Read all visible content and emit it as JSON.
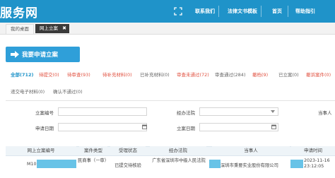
{
  "header": {
    "title": "服务网",
    "nav": [
      "联系我们",
      "法律文书模板",
      "首页",
      "帮助指引"
    ]
  },
  "tabs": [
    {
      "label": "我的桌面"
    },
    {
      "label": "网上立案"
    }
  ],
  "apply_button": {
    "label": "我要申请立案"
  },
  "filters": [
    {
      "label": "全部(712)"
    },
    {
      "label": "待提交(0)"
    },
    {
      "label": "待审查(93)"
    },
    {
      "label": "待补充材料(0)"
    },
    {
      "label": "已补充材料(0)"
    },
    {
      "label": "审查未通过(72)"
    },
    {
      "label": "审查通过(284)"
    },
    {
      "label": "撤档(9)"
    },
    {
      "label": "已立案(0)"
    },
    {
      "label": "撤诉案件(0)"
    },
    {
      "label": "递交电子材料(0)"
    },
    {
      "label": "确认不通过(0)"
    }
  ],
  "form": {
    "case_no_label": "立案编号",
    "court_label": "经办法院",
    "party_label": "当事人",
    "apply_date_label": "申请日期",
    "filing_date_label": "立案日期"
  },
  "table": {
    "headers": [
      "网上立案编号",
      "案件类型",
      "受理状态",
      "经办法院",
      "当事人",
      "申请时间"
    ],
    "rows": [
      {
        "case_no": "M10",
        "case_type": "民商事（一审）",
        "status": "已提交待核验",
        "court": "广东省深圳市中级人民法院",
        "party": "深圳市秉要实业股份有限公司",
        "time": "2023-11-16 23:12:05"
      }
    ]
  }
}
